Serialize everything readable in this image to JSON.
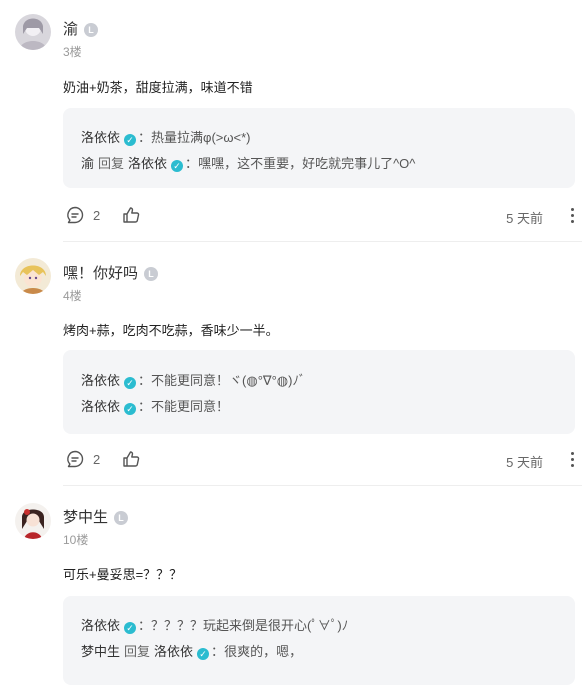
{
  "comments": [
    {
      "username": "渝",
      "level_badge": "L",
      "floor": "3楼",
      "text": "奶油+奶茶，甜度拉满，味道不错",
      "replies": [
        {
          "author": "洛依依",
          "sep": "：",
          "content": "热量拉满φ(>ω<*)"
        },
        {
          "author": "渝",
          "reply_word": "回复",
          "to": "洛依依",
          "sep": "：",
          "content": "嘿嘿，这不重要，好吃就完事儿了^O^"
        }
      ],
      "comment_count": "2",
      "time": "5 天前"
    },
    {
      "username": "嘿！你好吗",
      "level_badge": "L",
      "floor": "4楼",
      "text": "烤肉+蒜，吃肉不吃蒜，香味少一半。",
      "replies": [
        {
          "author": "洛依依",
          "sep": "：",
          "content": "不能更同意！ヾ(◍°∇°◍)ﾉﾞ"
        },
        {
          "author": "洛依依",
          "sep": "：",
          "content": "不能更同意！"
        }
      ],
      "comment_count": "2",
      "time": "5 天前"
    },
    {
      "username": "梦中生",
      "level_badge": "L",
      "floor": "10楼",
      "text": "可乐+曼妥思=？？？",
      "replies": [
        {
          "author": "洛依依",
          "sep": "：",
          "content": "？？？？玩起来倒是很开心(ﾟ∀ﾟ)ﾉ"
        },
        {
          "author": "梦中生",
          "reply_word": "回复",
          "to": "洛依依",
          "sep": "：",
          "content": "很爽的，嗯，"
        }
      ]
    }
  ],
  "icons": {
    "verified": "verified-check-icon",
    "comment": "comment-bubble-icon",
    "like": "thumbs-up-icon",
    "more": "more-vertical-icon"
  },
  "colors": {
    "verified": "#2bbcd0",
    "reply_box": "#f4f5f7",
    "meta": "#9a9a9a"
  }
}
